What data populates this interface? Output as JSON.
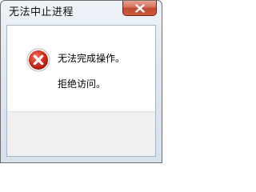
{
  "window": {
    "title": "无法中止进程"
  },
  "dialog": {
    "icon": "error-x-icon",
    "message_primary": "无法完成操作。",
    "message_secondary": "拒绝访问。"
  },
  "colors": {
    "close_button": "#c24a30",
    "error_icon": "#c9231a",
    "footer_bg": "#f0f0f0"
  }
}
